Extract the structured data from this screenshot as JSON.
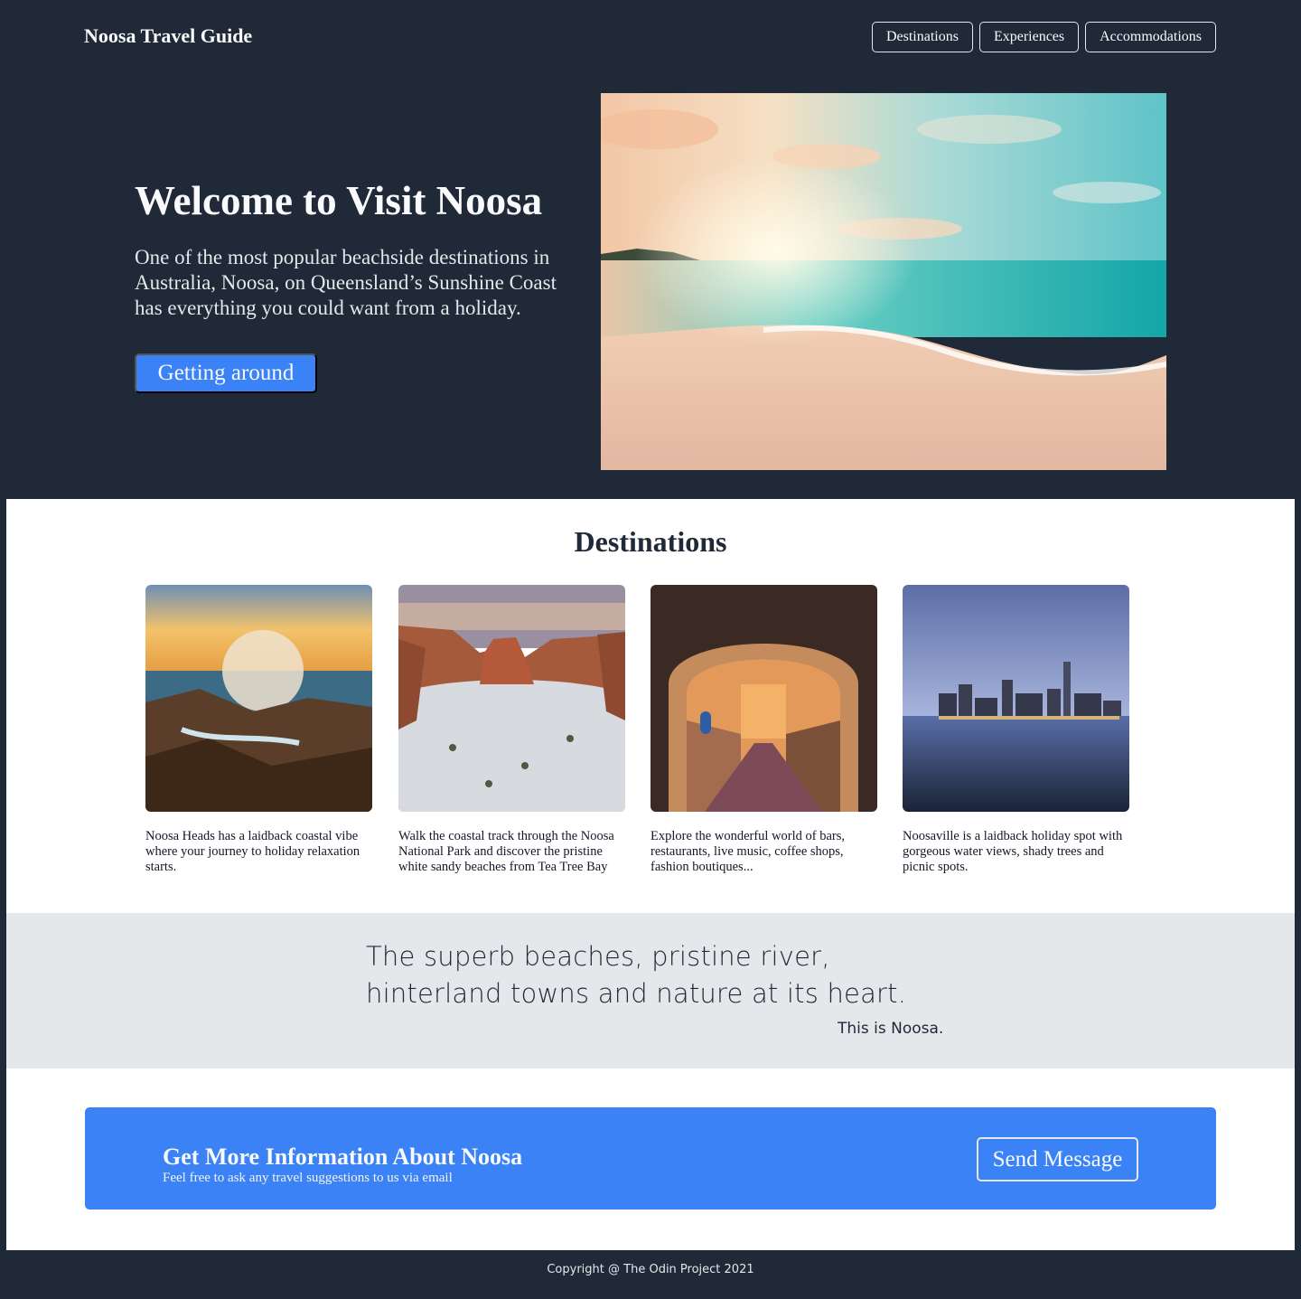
{
  "header": {
    "brand": "Noosa Travel Guide",
    "nav": [
      "Destinations",
      "Experiences",
      "Accommodations"
    ]
  },
  "hero": {
    "title": "Welcome to Visit Noosa",
    "text": "One of the most popular beachside destinations in Australia, Noosa, on Queensland’s Sunshine Coast has everything you could want from a holiday.",
    "button": "Getting around",
    "image": "beach-sunset-photo"
  },
  "destinations": {
    "title": "Destinations",
    "cards": [
      {
        "image": "coastal-rocks-waves-photo",
        "text": "Noosa Heads has a laidback coastal vibe where your journey to holiday relaxation starts."
      },
      {
        "image": "canyon-snow-photo",
        "text": "Walk the coastal track through the Noosa National Park and discover the pristine white sandy beaches from Tea Tree Bay"
      },
      {
        "image": "archway-street-photo",
        "text": "Explore the wonderful world of bars, restaurants, live music, coffee shops, fashion boutiques..."
      },
      {
        "image": "city-skyline-night-photo",
        "text": "Noosaville is a laidback holiday spot with gorgeous water views, shady trees and picnic spots."
      }
    ]
  },
  "quote": {
    "text": "The superb beaches, pristine river, hinterland towns and nature at its heart.",
    "author": "This is Noosa."
  },
  "info": {
    "title": "Get More Information About Noosa",
    "subtitle": "Feel free to ask any travel suggestions to us via email",
    "button": "Send Message"
  },
  "footer": {
    "copyright": "Copyright @ The Odin Project 2021"
  },
  "colors": {
    "dark": "#1f2937",
    "accent": "#3b82f6",
    "light_gray": "#e5e7eb"
  }
}
